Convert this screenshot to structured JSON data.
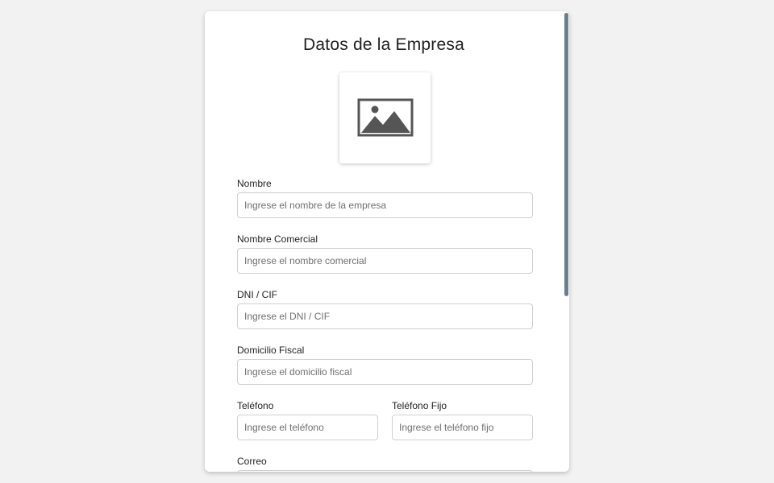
{
  "form": {
    "title": "Datos de la Empresa",
    "logo_icon": "image-placeholder-icon",
    "fields": {
      "nombre": {
        "label": "Nombre",
        "placeholder": "Ingrese el nombre de la empresa",
        "value": ""
      },
      "nombre_comercial": {
        "label": "Nombre Comercial",
        "placeholder": "Ingrese el nombre comercial",
        "value": ""
      },
      "dni_cif": {
        "label": "DNI / CIF",
        "placeholder": "Ingrese el DNI / CIF",
        "value": ""
      },
      "domicilio_fiscal": {
        "label": "Domicilio Fiscal",
        "placeholder": "Ingrese el domicilio fiscal",
        "value": ""
      },
      "telefono": {
        "label": "Teléfono",
        "placeholder": "Ingrese el teléfono",
        "value": ""
      },
      "telefono_fijo": {
        "label": "Teléfono Fijo",
        "placeholder": "Ingrese el teléfono fijo",
        "value": ""
      },
      "correo": {
        "label": "Correo"
      }
    }
  },
  "colors": {
    "background": "#f2f2f2",
    "card": "#ffffff",
    "scrollbar_thumb": "#6b7f91",
    "input_border": "#cfcfcf",
    "icon": "#555555"
  }
}
